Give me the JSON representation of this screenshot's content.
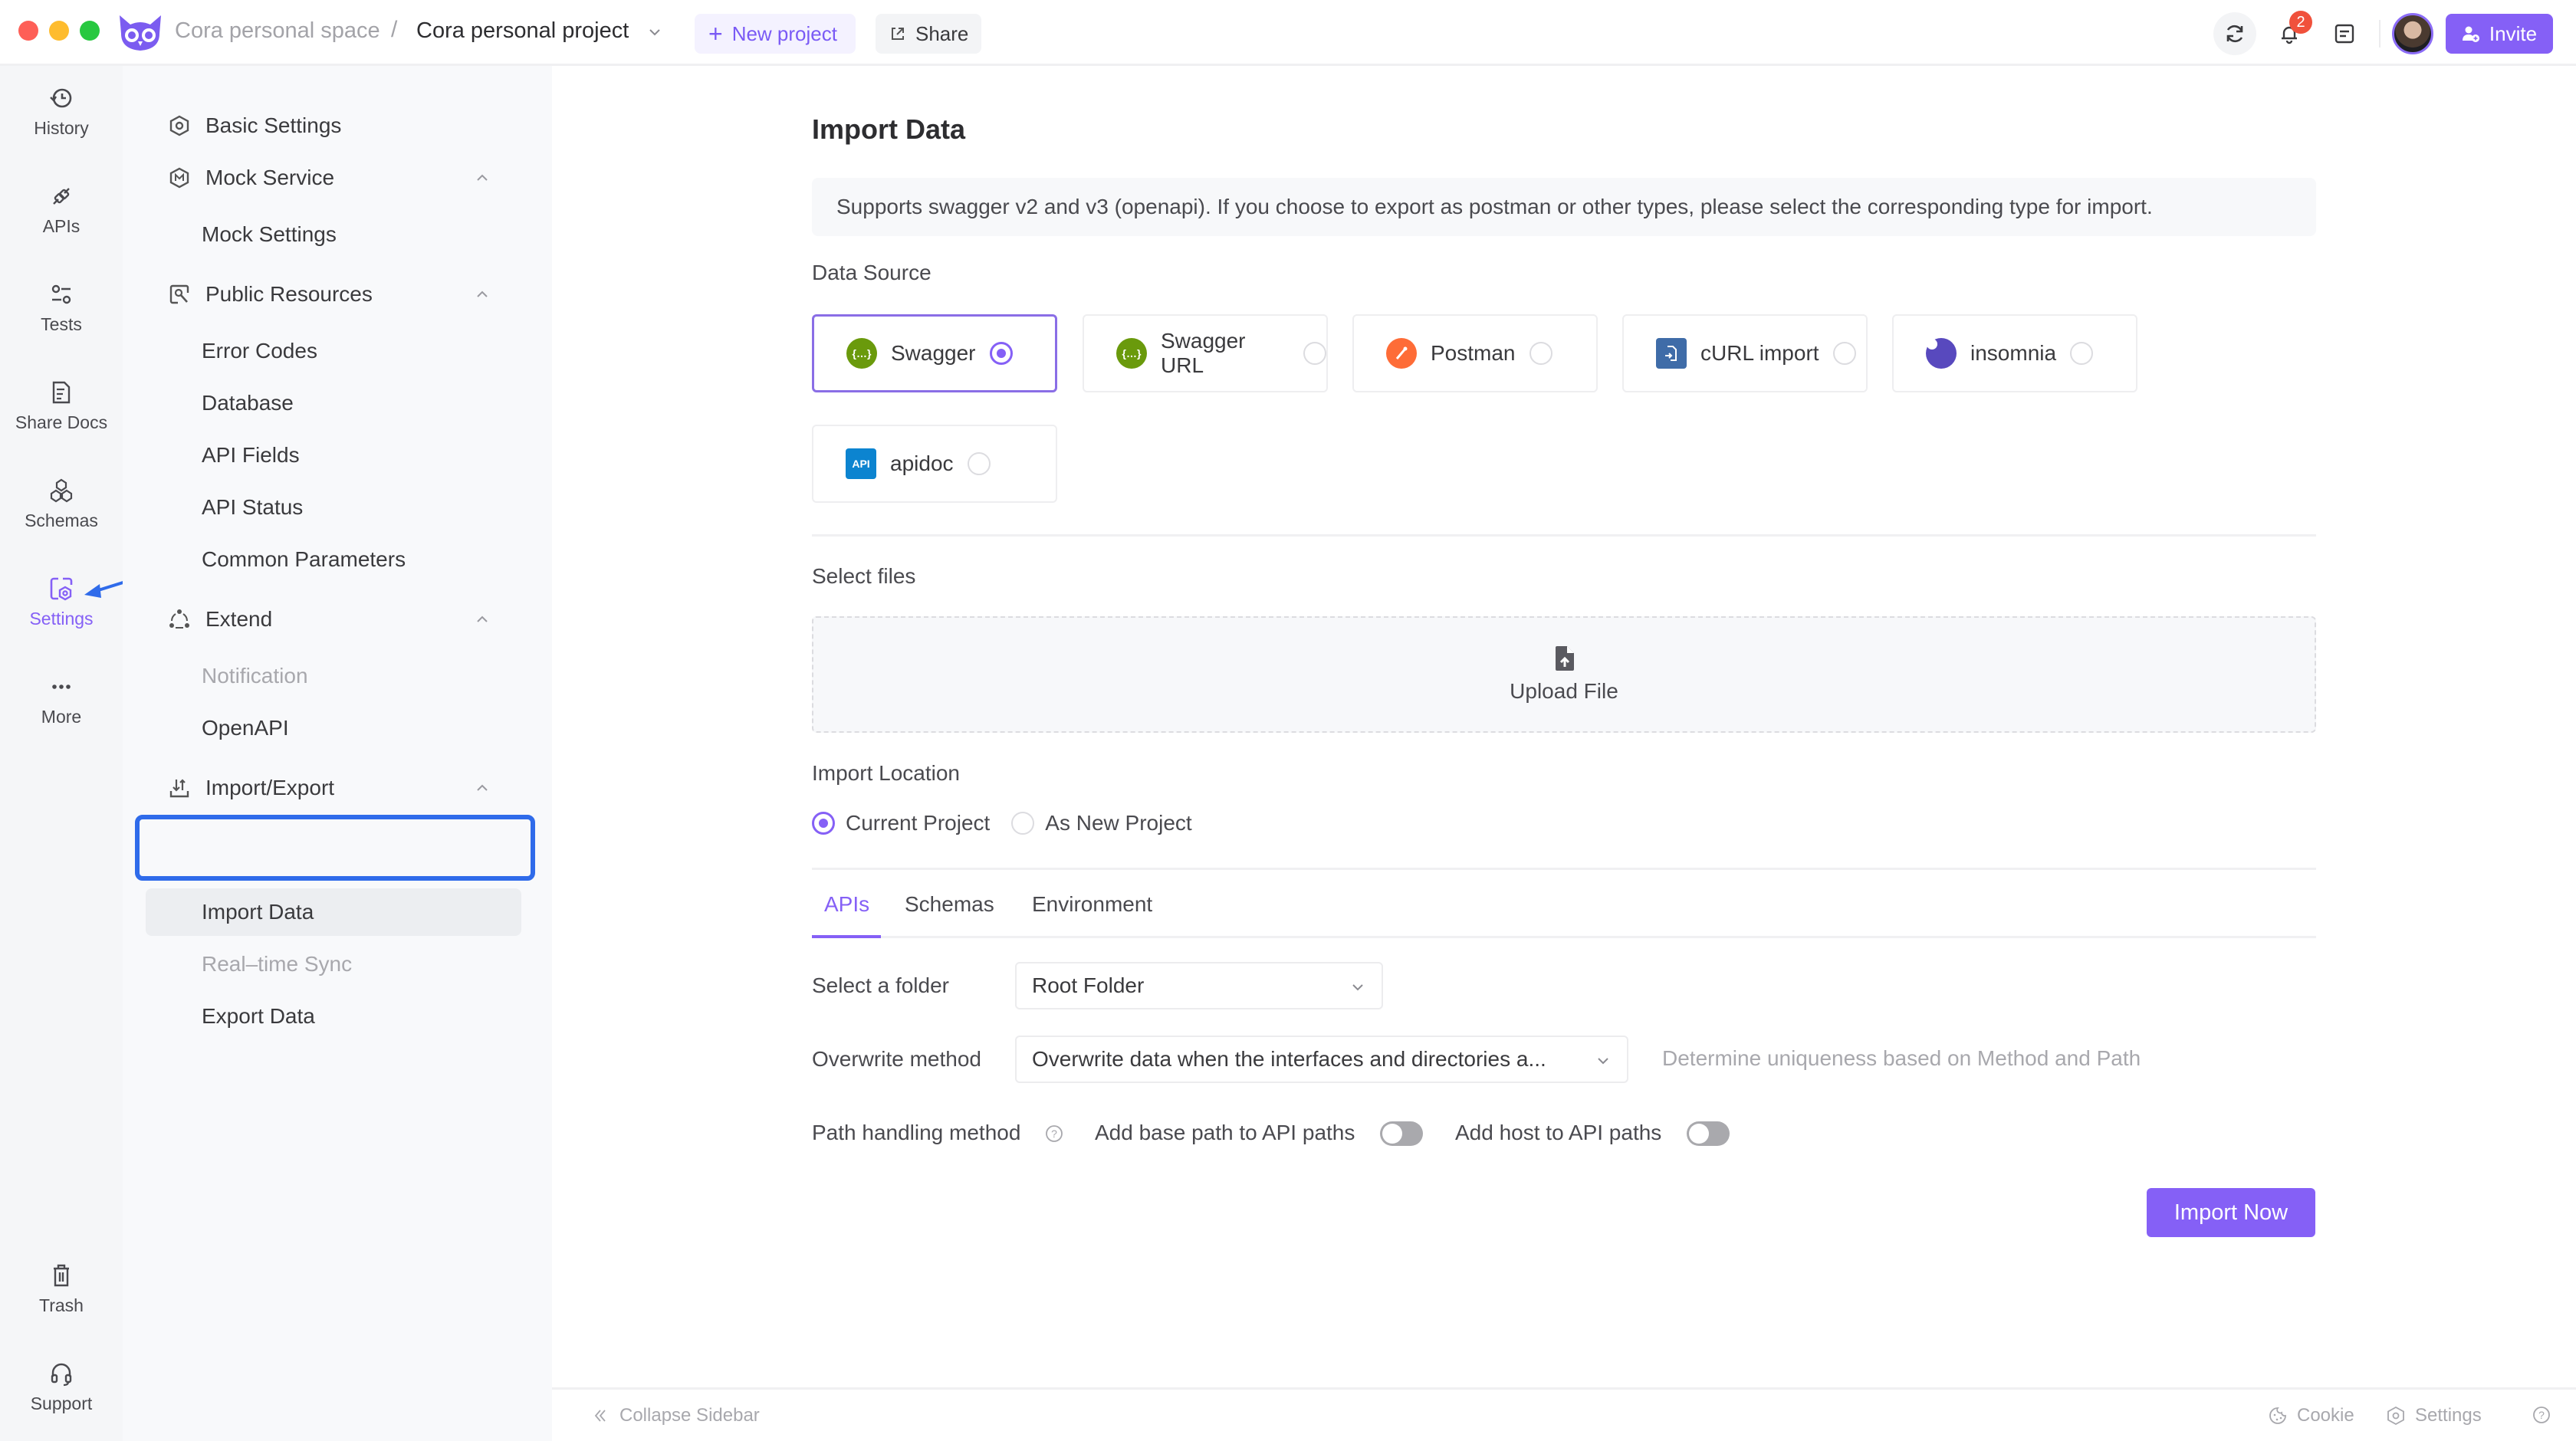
{
  "titlebar": {
    "workspace": "Cora personal space",
    "separator": "/",
    "project": "Cora personal project",
    "new_project": "New project",
    "share": "Share",
    "notification_count": "2",
    "invite": "Invite"
  },
  "rail": {
    "items": [
      {
        "label": "History",
        "icon": "history-icon"
      },
      {
        "label": "APIs",
        "icon": "api-plug-icon"
      },
      {
        "label": "Tests",
        "icon": "tests-icon"
      },
      {
        "label": "Share Docs",
        "icon": "share-docs-icon"
      },
      {
        "label": "Schemas",
        "icon": "schemas-icon"
      },
      {
        "label": "Settings",
        "icon": "settings-icon",
        "active": true
      },
      {
        "label": "More",
        "icon": "more-icon"
      }
    ],
    "bottom": [
      {
        "label": "Trash",
        "icon": "trash-icon"
      },
      {
        "label": "Support",
        "icon": "headset-icon"
      }
    ]
  },
  "sidebar": {
    "basic_settings": "Basic Settings",
    "mock_service": "Mock Service",
    "mock_settings": "Mock Settings",
    "public_resources": "Public Resources",
    "error_codes": "Error Codes",
    "database": "Database",
    "api_fields": "API Fields",
    "api_status": "API Status",
    "common_parameters": "Common Parameters",
    "extend": "Extend",
    "notification": "Notification",
    "openapi": "OpenAPI",
    "import_export": "Import/Export",
    "import_data": "Import Data",
    "realtime_sync": "Real–time Sync",
    "export_data": "Export Data"
  },
  "main": {
    "title": "Import Data",
    "notice": "Supports swagger v2 and v3 (openapi). If you choose to export as postman or other types, please select the corresponding type for import.",
    "data_source_label": "Data Source",
    "sources": [
      {
        "label": "Swagger",
        "selected": true,
        "color": "#6a9a0c"
      },
      {
        "label": "Swagger URL",
        "selected": false,
        "color": "#6a9a0c"
      },
      {
        "label": "Postman",
        "selected": false,
        "color": "#fe6c37"
      },
      {
        "label": "cURL import",
        "selected": false,
        "color": "#3f6ca8"
      },
      {
        "label": "insomnia",
        "selected": false,
        "color": "#5849be"
      },
      {
        "label": "apidoc",
        "selected": false,
        "color": "#0c84d0"
      }
    ],
    "apidoc_icon_text": "API",
    "select_files_label": "Select files",
    "upload_label": "Upload File",
    "import_location_label": "Import Location",
    "location_options": [
      {
        "label": "Current Project",
        "selected": true
      },
      {
        "label": "As New Project",
        "selected": false
      }
    ],
    "tabs": [
      {
        "label": "APIs",
        "active": true
      },
      {
        "label": "Schemas",
        "active": false
      },
      {
        "label": "Environment",
        "active": false
      }
    ],
    "folder_label": "Select a folder",
    "folder_value": "Root Folder",
    "overwrite_label": "Overwrite method",
    "overwrite_value": "Overwrite data when the interfaces and directories a...",
    "overwrite_hint": "Determine uniqueness based on Method and Path",
    "path_label": "Path handling method",
    "base_path_label": "Add base path to API paths",
    "base_path_on": false,
    "host_label": "Add host to API paths",
    "host_on": false,
    "import_button": "Import Now"
  },
  "footer": {
    "collapse": "Collapse Sidebar",
    "cookie": "Cookie",
    "settings": "Settings"
  },
  "colors": {
    "accent": "#8560f6",
    "highlight_frame": "#2f6bea"
  }
}
